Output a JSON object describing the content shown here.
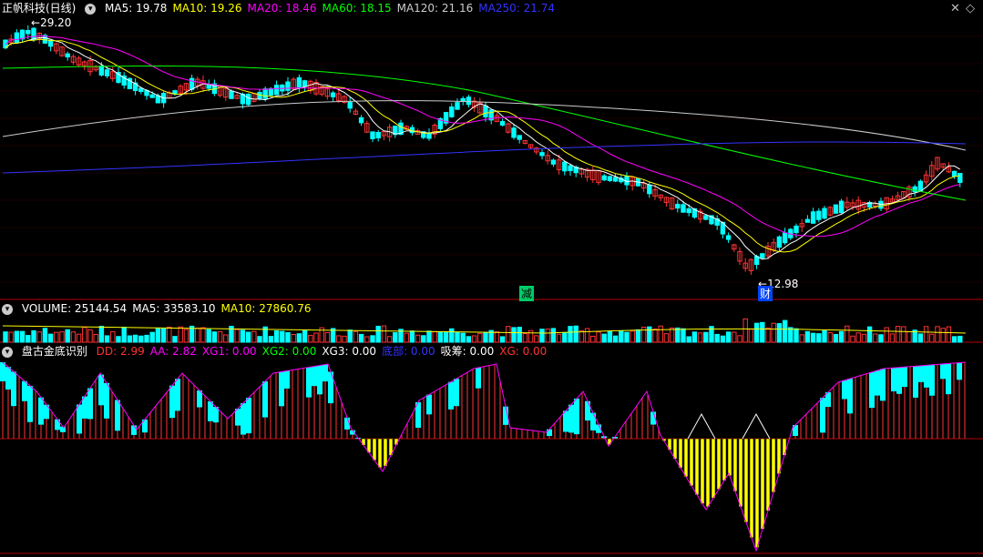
{
  "main_panel": {
    "stock": "正帆科技(日线)",
    "legend": [
      {
        "label": "MA5: 19.78",
        "color": "#ffffff"
      },
      {
        "label": "MA10: 19.26",
        "color": "#ffff00"
      },
      {
        "label": "MA20: 18.46",
        "color": "#ff00ff"
      },
      {
        "label": "MA60: 18.15",
        "color": "#00ff00"
      },
      {
        "label": "MA120: 21.16",
        "color": "#cccccc"
      },
      {
        "label": "MA250: 21.74",
        "color": "#3333ff"
      }
    ],
    "high_label": "29.20",
    "low_label": "12.98",
    "marker_jian": "减",
    "marker_cai": "财",
    "close_icon": "close-icon",
    "diamond_icon": "diamond-icon"
  },
  "volume_panel": {
    "legend": [
      {
        "label": "VOLUME: 25144.54",
        "color": "#ffffff"
      },
      {
        "label": "MA5: 33583.10",
        "color": "#ffffff"
      },
      {
        "label": "MA10: 27860.76",
        "color": "#ffff00"
      }
    ]
  },
  "indicator_panel": {
    "name": "盘古金底识别",
    "legend": [
      {
        "label": "DD: 2.99",
        "color": "#ff3333"
      },
      {
        "label": "AA: 2.82",
        "color": "#ff00ff"
      },
      {
        "label": "XG1: 0.00",
        "color": "#ff00ff"
      },
      {
        "label": "XG2: 0.00",
        "color": "#00ff00"
      },
      {
        "label": "XG3: 0.00",
        "color": "#ffffff"
      },
      {
        "label": "底部: 0.00",
        "color": "#3333ff"
      },
      {
        "label": "吸筹: 0.00",
        "color": "#ffffff"
      },
      {
        "label": "XG: 0.00",
        "color": "#ff3333"
      }
    ]
  },
  "chart_data": {
    "type": "line",
    "price_high": 29.2,
    "price_low": 12.98,
    "ma_values": {
      "MA5": 19.78,
      "MA10": 19.26,
      "MA20": 18.46,
      "MA60": 18.15,
      "MA120": 21.16,
      "MA250": 21.74
    },
    "volume_last": 25144.54,
    "colors": {
      "up": "#ff3333",
      "down": "#00ffff",
      "ma5": "#ffffff",
      "ma10": "#ffff00",
      "ma20": "#ff00ff",
      "ma60": "#00ff00",
      "ma120": "#cccccc",
      "ma250": "#3333ff",
      "yellow_bar": "#ffff00"
    }
  }
}
